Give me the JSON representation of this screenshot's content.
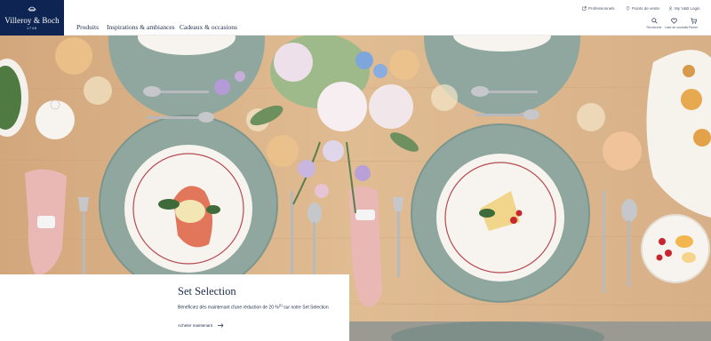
{
  "brand": {
    "name": "Villeroy & Boch",
    "since": "1748",
    "color": "#0e2452"
  },
  "utility_nav": {
    "professionals": "Professionnels",
    "stores": "Points de vente",
    "login": "My V&B Login"
  },
  "main_nav": [
    "Produits",
    "Inspirations & ambiances",
    "Cadeaux & occasions"
  ],
  "header_icons": {
    "search": "Recherche",
    "wishlist": "Liste de souhaits",
    "cart": "Panier"
  },
  "promo": {
    "title": "Set Selection",
    "text": "Bénéficiez dès maintenant d'une réduction de 20 %",
    "footnote": "[1]",
    "text_end": " sur notre Set Selection",
    "cta": "Acheter maintenant"
  },
  "colors": {
    "table": "#d8b088",
    "placemat": "#8fa79e",
    "plate": "#f7f4ef",
    "plate_rim": "#b64a52"
  }
}
